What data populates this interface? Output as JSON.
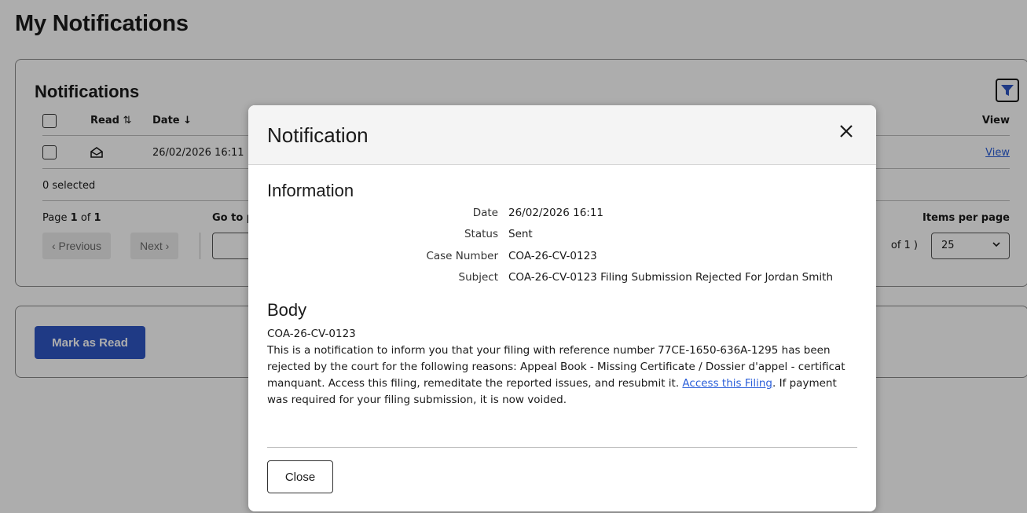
{
  "page": {
    "title": "My Notifications"
  },
  "notifications": {
    "title": "Notifications",
    "columns": {
      "read": "Read",
      "read_sort_icon": "⇅",
      "date": "Date",
      "date_sort_icon": "↓",
      "view": "View"
    },
    "rows": [
      {
        "read_icon": "envelope-open-icon",
        "date": "26/02/2026 16:11",
        "view": "View"
      }
    ],
    "selected_text": "0 selected",
    "pagination": {
      "page_label": "Page",
      "page_current": "1",
      "page_of": "of",
      "page_total": "1",
      "goto_label": "Go to p",
      "previous": "‹ Previous",
      "next": "Next ›",
      "of_suffix": "of 1 )",
      "items_per_page_label": "Items per page",
      "items_per_page_value": "25"
    }
  },
  "actions": {
    "mark_as_read": "Mark as Read"
  },
  "modal": {
    "title": "Notification",
    "information_heading": "Information",
    "info": [
      {
        "label": "Date",
        "value": "26/02/2026 16:11"
      },
      {
        "label": "Status",
        "value": "Sent"
      },
      {
        "label": "Case Number",
        "value": "COA-26-CV-0123"
      },
      {
        "label": "Subject",
        "value": "COA-26-CV-0123 Filing Submission Rejected For Jordan Smith"
      }
    ],
    "body_heading": "Body",
    "body": {
      "line1": "COA-26-CV-0123",
      "text_before_link": "This is a notification to inform you that your filing with reference number 77CE-1650-636A-1295 has been rejected by the court for the following reasons: Appeal Book - Missing Certificate / Dossier d'appel - certificat manquant. Access this filing, remeditate the reported issues, and resubmit it. ",
      "link_text": "Access this Filing",
      "text_after_link": ". If payment was required for your filing submission, it is now voided."
    },
    "close_button": "Close"
  },
  "colors": {
    "primary": "#2f56c4",
    "link": "#2b5fd9",
    "overlay": "rgba(0,0,0,0.32)"
  }
}
